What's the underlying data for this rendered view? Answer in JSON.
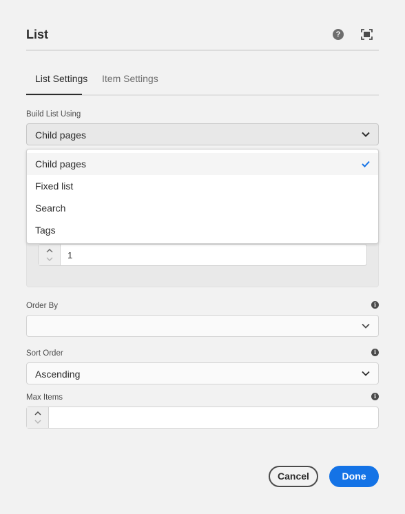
{
  "dialog": {
    "title": "List",
    "help_icon_glyph": "?",
    "help_icon": "help-icon",
    "fullscreen_icon": "fullscreen-icon"
  },
  "tabs": [
    {
      "label": "List Settings",
      "active": true
    },
    {
      "label": "Item Settings",
      "active": false
    }
  ],
  "build_list": {
    "label": "Build List Using",
    "value": "Child pages",
    "options": [
      {
        "label": "Child pages",
        "selected": true
      },
      {
        "label": "Fixed list",
        "selected": false
      },
      {
        "label": "Search",
        "selected": false
      },
      {
        "label": "Tags",
        "selected": false
      }
    ]
  },
  "depth_field": {
    "value": "1"
  },
  "order_by": {
    "label": "Order By",
    "value": "",
    "info_glyph": "i"
  },
  "sort_order": {
    "label": "Sort Order",
    "value": "Ascending",
    "info_glyph": "i"
  },
  "max_items": {
    "label": "Max Items",
    "value": "",
    "info_glyph": "i"
  },
  "buttons": {
    "cancel": "Cancel",
    "done": "Done"
  },
  "colors": {
    "background": "#f2f2f2",
    "accent": "#1473e6",
    "text": "#2c2c2c",
    "checkmark": "#1473e6"
  }
}
